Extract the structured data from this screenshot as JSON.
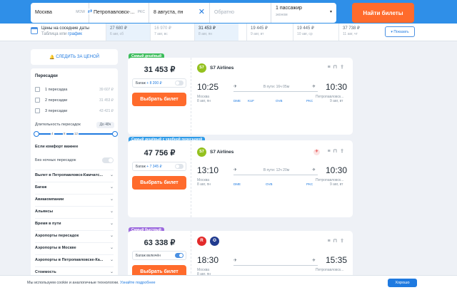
{
  "search": {
    "from": "Москва",
    "from_code": "MOW",
    "to": "Петропавловск-...",
    "to_code": "PKC",
    "date": "8 августа, пн",
    "back_placeholder": "Обратно",
    "passengers": "1 пассажир",
    "class": "эконом",
    "find_button": "Найти билеты"
  },
  "strip": {
    "title": "Цены на соседние даты",
    "sub_prefix": "Таблица или",
    "sub_link": "график",
    "cells": [
      {
        "price": "27 680 ₽",
        "date": "6 авг, сб"
      },
      {
        "price": "16 970 ₽",
        "date": "7 авг, вс"
      },
      {
        "price": "31 453 ₽",
        "date": "8 авг, пн"
      },
      {
        "price": "19 445 ₽",
        "date": "9 авг, вт"
      },
      {
        "price": "19 445 ₽",
        "date": "10 авг, ср"
      },
      {
        "price": "37 738 ₽",
        "date": "11 авг, чт"
      }
    ],
    "show_button": "Показать"
  },
  "sidebar": {
    "watch_price": "СЛЕДИТЬ ЗА ЦЕНОЙ",
    "transfers_title": "Пересадки",
    "transfers": [
      {
        "label": "1 пересадка",
        "price": "39 607 ₽"
      },
      {
        "label": "2 пересадки",
        "price": "31 453 ₽"
      },
      {
        "label": "3 пересадки",
        "price": "43 421 ₽"
      }
    ],
    "duration_label": "Длительность пересадок",
    "duration_badge": "До 48ч",
    "ticks": [
      "4",
      "8",
      "12"
    ],
    "comfort_title": "Если комфорт важнее",
    "no_night": "Без ночных пересадок",
    "accordions": [
      "Вылет в Петропавловск-Камчатс...",
      "Багаж",
      "Авиакомпании",
      "Альянсы",
      "Время в пути",
      "Аэропорты пересадок",
      "Аэропорты в Москве",
      "Аэропорты в Петропавловске-Ка...",
      "Стоимость"
    ]
  },
  "tickets": [
    {
      "tag": "Самый дешёвый",
      "tag_color": "#3cbd5b",
      "price": "31 453 ₽",
      "bag_label": "Багаж",
      "bag_price": "+ 8 200 ₽",
      "choose": "Выбрать билет",
      "airline": "S7 Airlines",
      "dep_time": "10:25",
      "arr_time": "10:30",
      "dep_city": "Москва",
      "dep_date": "8 авг, пн",
      "arr_city": "Петропавловск...",
      "arr_date": "9 авг, вт",
      "duration": "В пути: 16ч 05м",
      "iata": [
        "DME",
        "KUF",
        "OVB",
        "PKC"
      ]
    },
    {
      "tag": "Самый дешёвый с удобной пересадкой",
      "tag_color": "#2f9be8",
      "price": "47 756 ₽",
      "bag_label": "Багаж",
      "bag_price": "+ 7 345 ₽",
      "choose": "Выбрать билет",
      "airline": "S7 Airlines",
      "dep_time": "13:10",
      "arr_time": "10:30",
      "dep_city": "Москва",
      "dep_date": "8 авг, пн",
      "arr_city": "Петропавловск...",
      "arr_date": "9 авг, вт",
      "duration": "В пути: 12ч 20м",
      "iata": [
        "DME",
        "OVB",
        "PKC"
      ]
    },
    {
      "tag": "Самый быстрый",
      "tag_color": "#9c6ade",
      "price": "63 338 ₽",
      "bag_label": "Багаж включён",
      "choose": "Выбрать билет",
      "dep_time": "18:30",
      "arr_time": "15:35",
      "dep_city": "Москва",
      "dep_date": "8 авг, пн",
      "arr_city": "Петропавловск..."
    }
  ],
  "cookie": {
    "text": "Мы используем cookie и аналогичные технологии.",
    "link": "Узнайте подробнее",
    "ok": "Хорошо"
  }
}
